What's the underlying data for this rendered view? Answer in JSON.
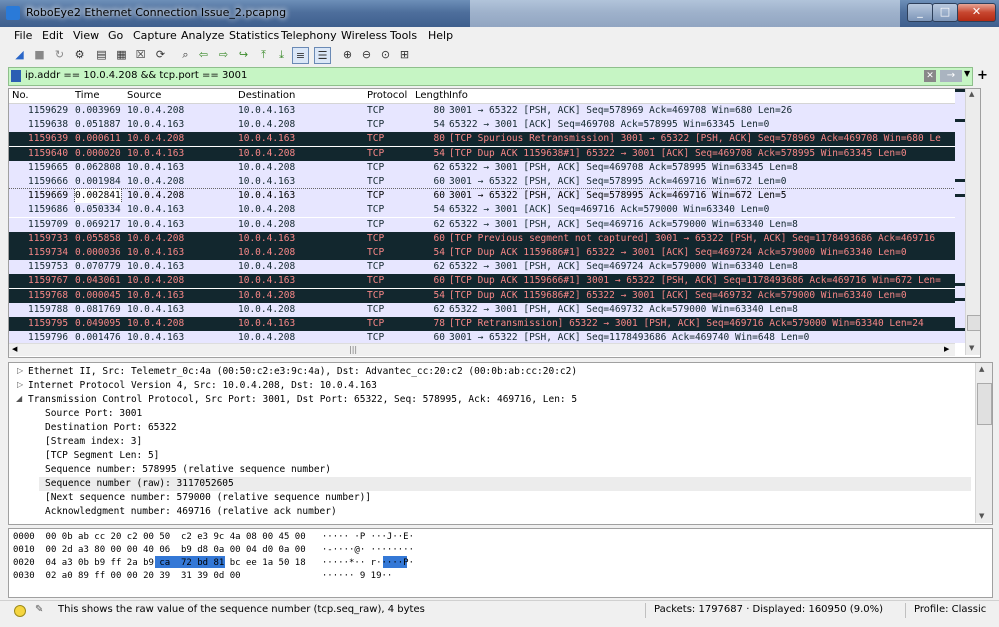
{
  "window": {
    "title": "RoboEye2 Ethernet Connection Issue_2.pcapng",
    "min": "_",
    "max": "□",
    "close": "✕"
  },
  "menu": [
    "File",
    "Edit",
    "View",
    "Go",
    "Capture",
    "Analyze",
    "Statistics",
    "Telephony",
    "Wireless",
    "Tools",
    "Help"
  ],
  "toolbar_icons": [
    "shark-start-icon",
    "stop-icon",
    "restart-icon",
    "options-icon",
    "open-icon",
    "save-icon",
    "close-file-icon",
    "reload-icon",
    "find-icon",
    "back-icon",
    "forward-icon",
    "go-to-icon",
    "first-icon",
    "last-icon",
    "autoscroll-icon",
    "colorize-icon",
    "zoom-in-icon",
    "zoom-out-icon",
    "zoom-normal-icon",
    "resize-columns-icon"
  ],
  "filter": {
    "value": "ip.addr == 10.0.4.208 && tcp.port == 3001",
    "apply": "→",
    "plus": "+"
  },
  "columns": {
    "no": "No.",
    "time": "Time",
    "source": "Source",
    "destination": "Destination",
    "protocol": "Protocol",
    "length": "Length",
    "info": "Info"
  },
  "packets": [
    {
      "no": "1159629",
      "time": "0.003969",
      "src": "10.0.4.208",
      "dst": "10.0.4.163",
      "proto": "TCP",
      "len": "80",
      "info": "3001 → 65322 [PSH, ACK] Seq=578969 Ack=469708 Win=680 Len=26",
      "style": "normal"
    },
    {
      "no": "1159638",
      "time": "0.051887",
      "src": "10.0.4.163",
      "dst": "10.0.4.208",
      "proto": "TCP",
      "len": "54",
      "info": "65322 → 3001 [ACK] Seq=469708 Ack=578995 Win=63345 Len=0",
      "style": "normal"
    },
    {
      "no": "1159639",
      "time": "0.000611",
      "src": "10.0.4.208",
      "dst": "10.0.4.163",
      "proto": "TCP",
      "len": "80",
      "info": "[TCP Spurious Retransmission] 3001 → 65322 [PSH, ACK] Seq=578969 Ack=469708 Win=680 Le",
      "style": "bad"
    },
    {
      "no": "1159640",
      "time": "0.000020",
      "src": "10.0.4.163",
      "dst": "10.0.4.208",
      "proto": "TCP",
      "len": "54",
      "info": "[TCP Dup ACK 1159638#1] 65322 → 3001 [ACK] Seq=469708 Ack=578995 Win=63345 Len=0",
      "style": "bad"
    },
    {
      "no": "1159665",
      "time": "0.062808",
      "src": "10.0.4.163",
      "dst": "10.0.4.208",
      "proto": "TCP",
      "len": "62",
      "info": "65322 → 3001 [PSH, ACK] Seq=469708 Ack=578995 Win=63345 Len=8",
      "style": "normal"
    },
    {
      "no": "1159666",
      "time": "0.001984",
      "src": "10.0.4.208",
      "dst": "10.0.4.163",
      "proto": "TCP",
      "len": "60",
      "info": "3001 → 65322 [PSH, ACK] Seq=578995 Ack=469716 Win=672 Len=0",
      "style": "normal"
    },
    {
      "no": "1159669",
      "time": "0.002841",
      "src": "10.0.4.208",
      "dst": "10.0.4.163",
      "proto": "TCP",
      "len": "60",
      "info": "3001 → 65322 [PSH, ACK] Seq=578995 Ack=469716 Win=672 Len=5",
      "style": "sel"
    },
    {
      "no": "1159686",
      "time": "0.050334",
      "src": "10.0.4.163",
      "dst": "10.0.4.208",
      "proto": "TCP",
      "len": "54",
      "info": "65322 → 3001 [ACK] Seq=469716 Ack=579000 Win=63340 Len=0",
      "style": "normal"
    },
    {
      "no": "1159709",
      "time": "0.069217",
      "src": "10.0.4.163",
      "dst": "10.0.4.208",
      "proto": "TCP",
      "len": "62",
      "info": "65322 → 3001 [PSH, ACK] Seq=469716 Ack=579000 Win=63340 Len=8",
      "style": "normal"
    },
    {
      "no": "1159733",
      "time": "0.055858",
      "src": "10.0.4.208",
      "dst": "10.0.4.163",
      "proto": "TCP",
      "len": "60",
      "info": "[TCP Previous segment not captured] 3001 → 65322 [PSH, ACK] Seq=1178493686 Ack=469716",
      "style": "bad"
    },
    {
      "no": "1159734",
      "time": "0.000036",
      "src": "10.0.4.163",
      "dst": "10.0.4.208",
      "proto": "TCP",
      "len": "54",
      "info": "[TCP Dup ACK 1159686#1] 65322 → 3001 [ACK] Seq=469724 Ack=579000 Win=63340 Len=0",
      "style": "bad"
    },
    {
      "no": "1159753",
      "time": "0.070779",
      "src": "10.0.4.163",
      "dst": "10.0.4.208",
      "proto": "TCP",
      "len": "62",
      "info": "65322 → 3001 [PSH, ACK] Seq=469724 Ack=579000 Win=63340 Len=8",
      "style": "normal"
    },
    {
      "no": "1159767",
      "time": "0.043061",
      "src": "10.0.4.208",
      "dst": "10.0.4.163",
      "proto": "TCP",
      "len": "60",
      "info": "[TCP Dup ACK 1159666#1] 3001 → 65322 [PSH, ACK] Seq=1178493686 Ack=469716 Win=672 Len=",
      "style": "bad"
    },
    {
      "no": "1159768",
      "time": "0.000045",
      "src": "10.0.4.163",
      "dst": "10.0.4.208",
      "proto": "TCP",
      "len": "54",
      "info": "[TCP Dup ACK 1159686#2] 65322 → 3001 [ACK] Seq=469732 Ack=579000 Win=63340 Len=0",
      "style": "bad"
    },
    {
      "no": "1159788",
      "time": "0.081769",
      "src": "10.0.4.163",
      "dst": "10.0.4.208",
      "proto": "TCP",
      "len": "62",
      "info": "65322 → 3001 [PSH, ACK] Seq=469732 Ack=579000 Win=63340 Len=8",
      "style": "normal"
    },
    {
      "no": "1159795",
      "time": "0.049095",
      "src": "10.0.4.208",
      "dst": "10.0.4.163",
      "proto": "TCP",
      "len": "78",
      "info": "[TCP Retransmission] 65322 → 3001 [PSH, ACK] Seq=469716 Ack=579000 Win=63340 Len=24",
      "style": "bad"
    },
    {
      "no": "1159796",
      "time": "0.001476",
      "src": "10.0.4.163",
      "dst": "10.0.4.208",
      "proto": "TCP",
      "len": "60",
      "info": "3001 → 65322 [PSH, ACK] Seq=1178493686 Ack=469740 Win=648 Len=0",
      "style": "normal"
    }
  ],
  "details": {
    "ethernet": "Ethernet II, Src: Telemetr_0c:4a (00:50:c2:e3:9c:4a), Dst: Advantec_cc:20:c2 (00:0b:ab:cc:20:c2)",
    "ip": "Internet Protocol Version 4, Src: 10.0.4.208, Dst: 10.0.4.163",
    "tcp": "Transmission Control Protocol, Src Port: 3001, Dst Port: 65322, Seq: 578995, Ack: 469716, Len: 5",
    "fields": [
      "Source Port: 3001",
      "Destination Port: 65322",
      "[Stream index: 3]",
      "[TCP Segment Len: 5]",
      "Sequence number: 578995    (relative sequence number)",
      "Sequence number (raw): 3117052605",
      "[Next sequence number: 579000    (relative sequence number)]",
      "Acknowledgment number: 469716    (relative ack number)"
    ]
  },
  "bytes": [
    {
      "off": "0000",
      "hex": "00 0b ab cc 20 c2 00 50  c2 e3 9c 4a 08 00 45 00",
      "ascii": "····· ·P ···J··E·"
    },
    {
      "off": "0010",
      "hex": "00 2d a3 80 00 00 40 06  b9 d8 0a 00 04 d0 0a 00",
      "ascii": "·-····@· ········"
    },
    {
      "off": "0020",
      "hex": "04 a3 0b b9 ff 2a b9 ca  72 bd 81 bc ee 1a 50 18",
      "ascii": "·····*·· r·····P·"
    },
    {
      "off": "0030",
      "hex": "02 a0 89 ff 00 00 20 39  31 39 0d 00",
      "ascii": "······ 9 19··"
    }
  ],
  "status": {
    "message": "This shows the raw value of the sequence number (tcp.seq_raw), 4 bytes",
    "packets": "Packets: 1797687 · Displayed: 160950 (9.0%)",
    "profile": "Profile: Classic"
  },
  "colors": {
    "normal_bg": "#e7e6ff",
    "bad_bg": "#12272e",
    "bad_fg": "#f78787",
    "filter_ok": "#c6f5c4"
  }
}
